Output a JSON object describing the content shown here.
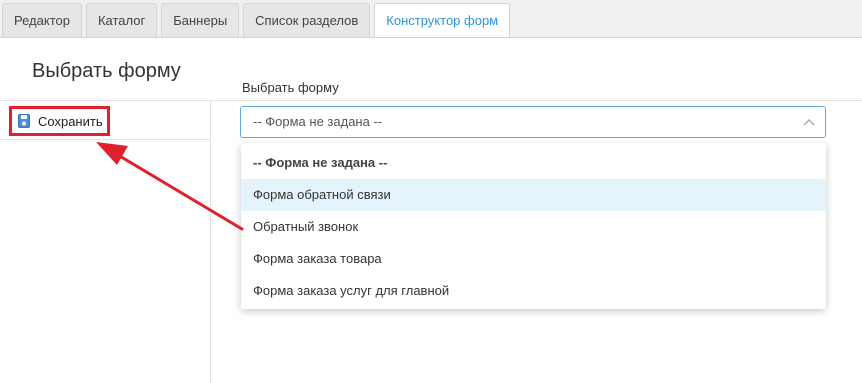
{
  "tabs": [
    {
      "label": "Редактор"
    },
    {
      "label": "Каталог"
    },
    {
      "label": "Баннеры"
    },
    {
      "label": "Список разделов"
    },
    {
      "label": "Конструктор форм"
    }
  ],
  "page": {
    "title": "Выбрать форму"
  },
  "sidebar": {
    "save_label": "Сохранить",
    "save_icon": "save-icon"
  },
  "form": {
    "label": "Выбрать форму",
    "selected": "-- Форма не задана --",
    "options": [
      "-- Форма не задана --",
      "Форма обратной связи",
      "Обратный звонок",
      "Форма заказа товара",
      "Форма заказа услуг для главной"
    ]
  },
  "colors": {
    "accent": "#2e94d6",
    "highlight": "#e1202d",
    "hover": "#e5f3fc"
  }
}
